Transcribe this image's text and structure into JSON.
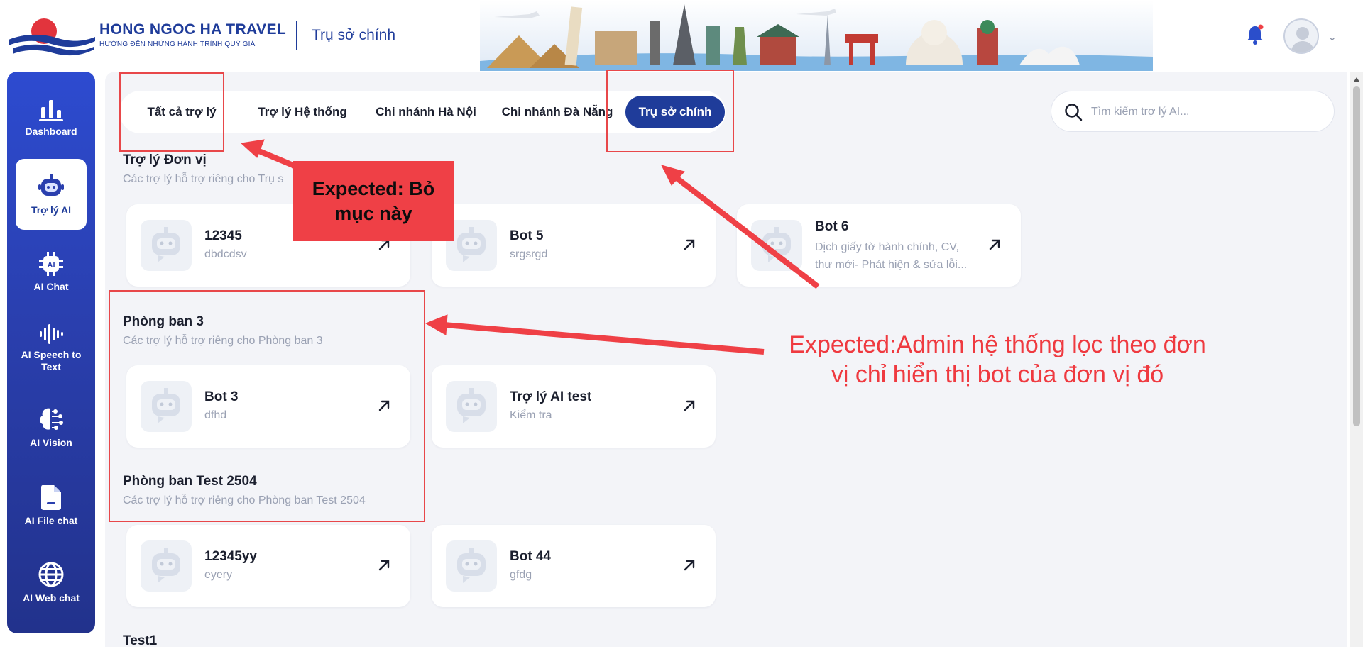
{
  "header": {
    "brand_name": "HONG NGOC HA TRAVEL",
    "brand_tagline": "HƯỚNG ĐẾN NHỮNG HÀNH TRÌNH QUÝ GIÁ",
    "current_branch": "Trụ sở chính",
    "notification_icon": "bell-icon",
    "profile_icon": "user-avatar-icon"
  },
  "sidebar": {
    "items": [
      {
        "label": "Dashboard",
        "icon": "bar-chart-icon"
      },
      {
        "label": "Trợ lý AI",
        "icon": "robot-icon",
        "active": true
      },
      {
        "label": "AI Chat",
        "icon": "ai-chip-icon"
      },
      {
        "label": "AI Speech to Text",
        "icon": "soundwave-icon"
      },
      {
        "label": "AI Vision",
        "icon": "brain-icon"
      },
      {
        "label": "AI File chat",
        "icon": "file-icon"
      },
      {
        "label": "AI Web chat",
        "icon": "globe-icon"
      }
    ]
  },
  "filters": {
    "tabs": [
      {
        "label": "Tất cả trợ lý"
      },
      {
        "label": "Trợ lý Hệ thống"
      },
      {
        "label": "Chi nhánh Hà Nội"
      },
      {
        "label": "Chi nhánh Đà Nẵng"
      },
      {
        "label": "Trụ sở chính",
        "active": true
      }
    ],
    "search_placeholder": "Tìm kiếm trợ lý AI..."
  },
  "sections": [
    {
      "title": "Trợ lý Đơn vị",
      "subtitle": "Các trợ lý hỗ trợ riêng cho Trụ s",
      "bots": [
        {
          "name": "12345",
          "desc": "dbdcdsv"
        },
        {
          "name": "Bot 5",
          "desc": "srgsrgd"
        },
        {
          "name": "Bot 6",
          "desc": "Dịch giấy tờ hành chính, CV, thư mới- Phát hiện & sửa lỗi..."
        }
      ]
    },
    {
      "title": "Phòng ban 3",
      "subtitle": "Các trợ lý hỗ trợ riêng cho Phòng ban 3",
      "bots": [
        {
          "name": "Bot 3",
          "desc": "dfhd"
        },
        {
          "name": "Trợ lý AI test",
          "desc": "Kiểm tra"
        }
      ]
    },
    {
      "title": "Phòng ban Test 2504",
      "subtitle": "Các trợ lý hỗ trợ riêng cho Phòng ban Test 2504",
      "bots": [
        {
          "name": "12345yy",
          "desc": "eyery"
        },
        {
          "name": "Bot 44",
          "desc": "gfdg"
        }
      ]
    },
    {
      "title": "Test1",
      "subtitle": "",
      "bots": []
    }
  ],
  "annotations": {
    "callout_remove": "Expected: Bỏ mục này",
    "callout_filter": "Expected:Admin hệ thống lọc theo đơn vị chỉ hiển thị bot của đơn vị đó"
  },
  "colors": {
    "brand_blue": "#1f3c9a",
    "annotation_red": "#ef4046",
    "background": "#f3f4f8"
  }
}
